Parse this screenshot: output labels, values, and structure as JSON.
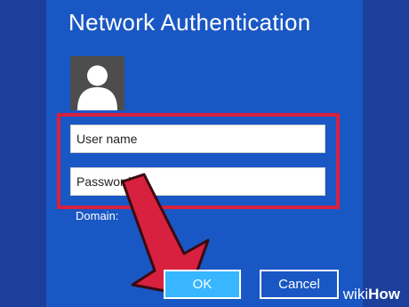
{
  "dialog": {
    "title": "Network Authentication",
    "username_placeholder": "User name",
    "password_placeholder": "Password",
    "domain_label": "Domain:",
    "ok_label": "OK",
    "cancel_label": "Cancel"
  },
  "icons": {
    "avatar": "user-silhouette-icon",
    "pointer": "red-pointer-arrow-icon"
  },
  "brand": {
    "part1": "wiki",
    "part2": "How"
  },
  "colors": {
    "background": "#1957c4",
    "frame": "#1c3f9c",
    "highlight": "#d8203f",
    "ok_button": "#38b6ff",
    "arrow": "#d8203f"
  }
}
